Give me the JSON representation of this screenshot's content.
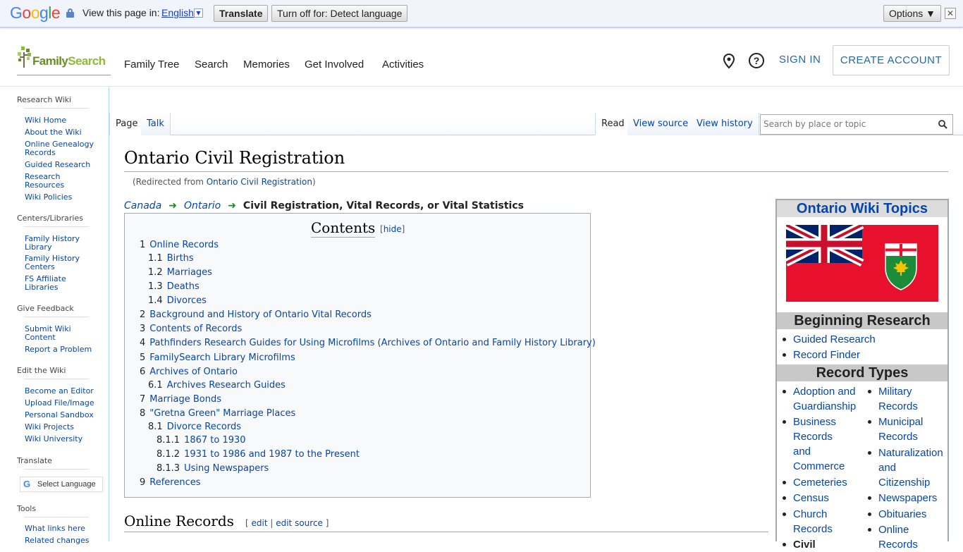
{
  "translate_bar": {
    "view_in": "View this page in:",
    "language": "English",
    "translate": "Translate",
    "turn_off": "Turn off for: Detect language",
    "options": "Options ▼",
    "close": "✕"
  },
  "header": {
    "logo_main": "Family",
    "logo_second": "Search",
    "nav": [
      "Family Tree",
      "Search",
      "Memories",
      "Get Involved",
      "Activities"
    ],
    "sign_in": "SIGN IN",
    "create_account": "CREATE ACCOUNT",
    "help": "?"
  },
  "sidebar": {
    "research_wiki": "Research Wiki",
    "rw_links": [
      "Wiki Home",
      "About the Wiki",
      "Online Genealogy Records",
      "Guided Research",
      "Research Resources",
      "Wiki Policies"
    ],
    "centers": "Centers/Libraries",
    "centers_links": [
      "Family History Library",
      "Family History Centers",
      "FS Affiliate Libraries"
    ],
    "feedback": "Give Feedback",
    "feedback_links": [
      "Submit Wiki Content",
      "Report a Problem"
    ],
    "edit": "Edit the Wiki",
    "edit_links": [
      "Become an Editor",
      "Upload File/Image",
      "Personal Sandbox",
      "Wiki Projects",
      "Wiki University"
    ],
    "translate": "Translate",
    "select_language": "Select Language",
    "tools": "Tools",
    "tools_links": [
      "What links here",
      "Related changes"
    ]
  },
  "tabs": {
    "page": "Page",
    "talk": "Talk",
    "read": "Read",
    "view_source": "View source",
    "view_history": "View history",
    "search_placeholder": "Search by place or topic"
  },
  "article": {
    "title": "Ontario Civil Registration",
    "redirect_prefix": "(Redirected from ",
    "redirect_link": "Ontario Civil Registration",
    "redirect_suffix": ")",
    "crumb1": "Canada",
    "crumb2": "Ontario",
    "crumb_current": "Civil Registration, Vital Records, or Vital Statistics",
    "toc_title": "Contents",
    "toc_hide": "hide",
    "toc": [
      {
        "n": "1",
        "t": "Online Records"
      },
      {
        "n": "1.1",
        "t": "Births"
      },
      {
        "n": "1.2",
        "t": "Marriages"
      },
      {
        "n": "1.3",
        "t": "Deaths"
      },
      {
        "n": "1.4",
        "t": "Divorces"
      },
      {
        "n": "2",
        "t": "Background and History of Ontario Vital Records"
      },
      {
        "n": "3",
        "t": "Contents of Records"
      },
      {
        "n": "4",
        "t": "Pathfinders Research Guides for Using Microfilms (Archives of Ontario and Family History Library)"
      },
      {
        "n": "5",
        "t": "FamilySearch Library Microfilms"
      },
      {
        "n": "6",
        "t": "Archives of Ontario"
      },
      {
        "n": "6.1",
        "t": "Archives Research Guides"
      },
      {
        "n": "7",
        "t": "Marriage Bonds"
      },
      {
        "n": "8",
        "t": "\"Gretna Green\" Marriage Places"
      },
      {
        "n": "8.1",
        "t": "Divorce Records"
      },
      {
        "n": "8.1.1",
        "t": "1867 to 1930"
      },
      {
        "n": "8.1.2",
        "t": "1931 to 1986 and 1987 to the Present"
      },
      {
        "n": "8.1.3",
        "t": "Using Newspapers"
      },
      {
        "n": "9",
        "t": "References"
      }
    ],
    "section_heading": "Online Records",
    "edit": "edit",
    "edit_source": "edit source"
  },
  "infobox": {
    "title": "Ontario Wiki Topics",
    "beginning": "Beginning Research",
    "beginning_links": [
      "Guided Research",
      "Record Finder"
    ],
    "record_types": "Record Types",
    "col1": [
      "Adoption and Guardianship",
      "Business Records and Commerce",
      "Cemeteries",
      "Census",
      "Church Records",
      "Civil"
    ],
    "col2": [
      "Military Records",
      "Municipal Records",
      "Naturalization and Citizenship",
      "Newspapers",
      "Obituaries",
      "Online Records"
    ]
  }
}
